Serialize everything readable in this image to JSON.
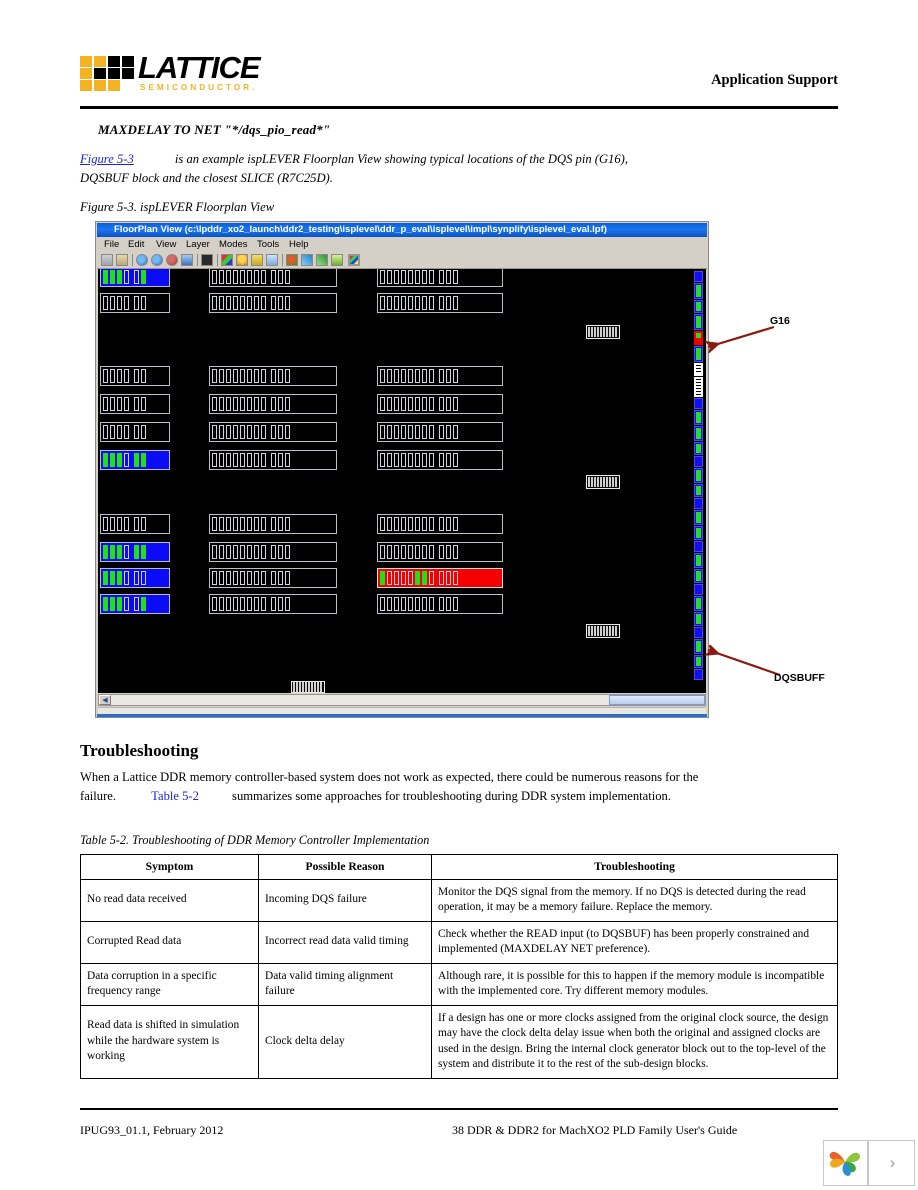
{
  "header": {
    "logo_word": "LATTICE",
    "logo_sub": "SEMICONDUCTOR.",
    "title": "Application Support"
  },
  "body": {
    "code_line": "MAXDELAY TO NET \"*/dqs_pio_read*\"",
    "para1_link": "Figure 5-3",
    "para1_rest": " is an example ispLEVER Floorplan View showing typical locations of the DQS pin (G16), DQSBUF block and the closest SLICE (R7C25D).",
    "figure_caption": "Figure 5-3. ispLEVER Floorplan View"
  },
  "floorplan_window": {
    "title": "FloorPlan View (c:\\lpddr_xo2_launch\\ddr2_testing\\isplevel\\ddr_p_eval\\isplevel\\impl\\synplify\\isplevel_eval.lpf)",
    "menus": [
      "File",
      "Edit",
      "View",
      "Layer",
      "Modes",
      "Tools",
      "Help"
    ],
    "toolbar_icons": [
      "save-icon",
      "print-icon",
      "zoom-in-icon",
      "zoom-out-icon",
      "zoom-select-icon",
      "zoom-fit-icon",
      "find-icon",
      "placement-icon",
      "bulb-icon",
      "route-icon",
      "region-icon",
      "highlight-icon",
      "netlist-icon",
      "connections-icon",
      "hierarchy-icon",
      "colors-icon"
    ],
    "callouts": [
      {
        "label": "G16"
      },
      {
        "label": "DQSBUFF"
      }
    ]
  },
  "troubleshooting": {
    "heading": "Troubleshooting",
    "para_part1": "When a Lattice DDR memory controller-based system does not work as expected, there could be numerous reasons for the failure. ",
    "para_link": "Table 5-2",
    "para_part2": " summarizes some approaches for troubleshooting during DDR system implementation.",
    "table_caption": "Table 5-2. Troubleshooting of DDR Memory Controller Implementation",
    "table": {
      "headers": [
        "Symptom",
        "Possible Reason",
        "Troubleshooting"
      ],
      "rows": [
        {
          "symptom": "No read data received",
          "reason": "Incoming DQS failure",
          "fix": "Monitor the DQS signal from the memory. If no DQS is detected during the read operation, it may be a memory failure. Replace the memory."
        },
        {
          "symptom": "Corrupted Read data",
          "reason": "Incorrect read data valid timing",
          "fix": "Check whether the READ input (to DQSBUF) has been properly constrained and implemented (MAXDELAY NET preference)."
        },
        {
          "symptom": "Data corruption in a specific frequency range",
          "reason": "Data valid timing alignment failure",
          "fix": "Although rare, it is possible for this to happen if the memory module is incompatible with the implemented core. Try different memory modules."
        },
        {
          "symptom": "Read data is shifted in simulation while the hardware system is working",
          "reason": "Clock delta delay",
          "fix": "If a design has one or more clocks assigned from the original clock source, the design may have the clock delta delay issue when both the original and assigned clocks are used in the design. Bring the internal clock generator block out to the top-level of the system and distribute it to the rest of the sub-design blocks."
        }
      ]
    }
  },
  "footer": {
    "left": "IPUG93_01.1, February 2012",
    "right": "38 DDR & DDR2 for MachXO2 PLD Family User's Guide"
  },
  "corner_widget": {
    "logo_icon": "pinwheel-logo-icon",
    "next_label": "›"
  },
  "colors": {
    "brand_yellow": "#f5b323",
    "link_blue": "#2222cc",
    "titlebar_blue": "#1c76ef",
    "canvas_black": "#000000",
    "select_blue": "#0b0bf5",
    "select_red": "#f40000",
    "pad_green": "#25e01a",
    "arrow_red": "#8b1a0f"
  }
}
